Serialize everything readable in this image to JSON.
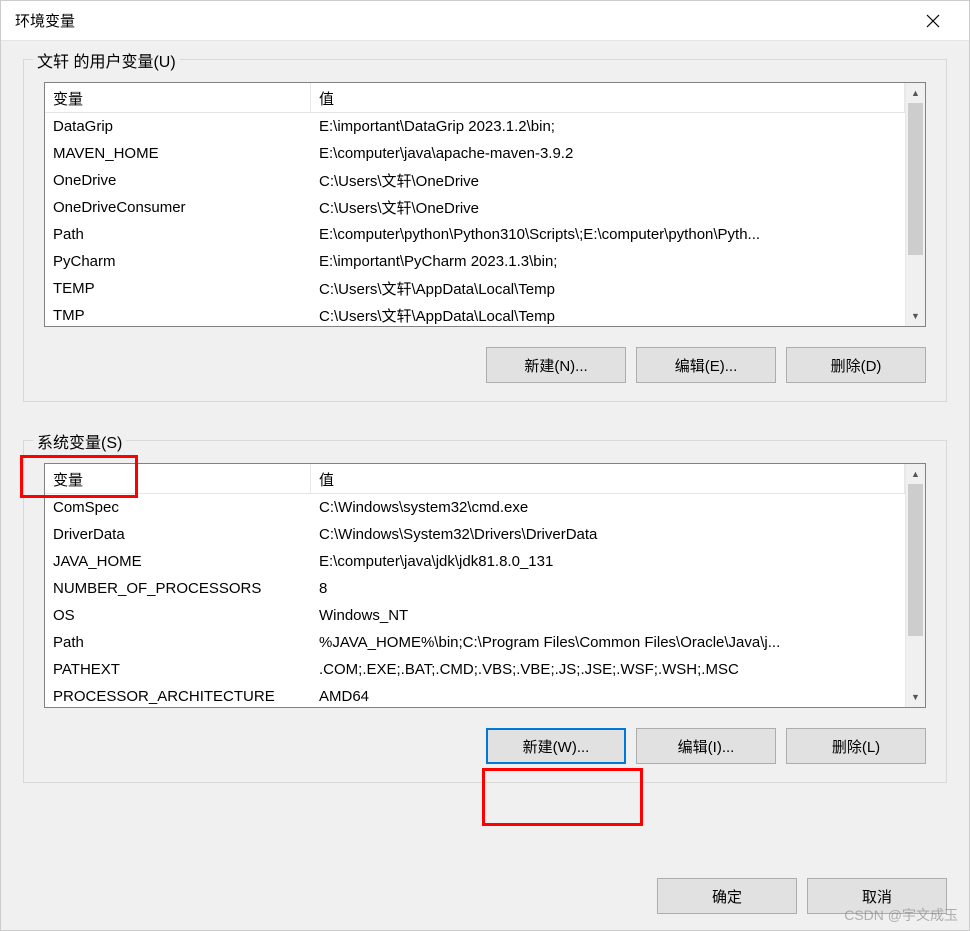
{
  "window": {
    "title": "环境变量"
  },
  "userVars": {
    "groupLabel": "文轩 的用户变量(U)",
    "headers": {
      "name": "变量",
      "value": "值"
    },
    "rows": [
      {
        "name": "DataGrip",
        "value": "E:\\important\\DataGrip 2023.1.2\\bin;"
      },
      {
        "name": "MAVEN_HOME",
        "value": "E:\\computer\\java\\apache-maven-3.9.2"
      },
      {
        "name": "OneDrive",
        "value": "C:\\Users\\文轩\\OneDrive"
      },
      {
        "name": "OneDriveConsumer",
        "value": "C:\\Users\\文轩\\OneDrive"
      },
      {
        "name": "Path",
        "value": "E:\\computer\\python\\Python310\\Scripts\\;E:\\computer\\python\\Pyth..."
      },
      {
        "name": "PyCharm",
        "value": "E:\\important\\PyCharm 2023.1.3\\bin;"
      },
      {
        "name": "TEMP",
        "value": "C:\\Users\\文轩\\AppData\\Local\\Temp"
      },
      {
        "name": "TMP",
        "value": "C:\\Users\\文轩\\AppData\\Local\\Temp"
      }
    ],
    "buttons": {
      "new": "新建(N)...",
      "edit": "编辑(E)...",
      "delete": "删除(D)"
    }
  },
  "sysVars": {
    "groupLabel": "系统变量(S)",
    "headers": {
      "name": "变量",
      "value": "值"
    },
    "rows": [
      {
        "name": "ComSpec",
        "value": "C:\\Windows\\system32\\cmd.exe"
      },
      {
        "name": "DriverData",
        "value": "C:\\Windows\\System32\\Drivers\\DriverData"
      },
      {
        "name": "JAVA_HOME",
        "value": "E:\\computer\\java\\jdk\\jdk81.8.0_131"
      },
      {
        "name": "NUMBER_OF_PROCESSORS",
        "value": "8"
      },
      {
        "name": "OS",
        "value": "Windows_NT"
      },
      {
        "name": "Path",
        "value": "%JAVA_HOME%\\bin;C:\\Program Files\\Common Files\\Oracle\\Java\\j..."
      },
      {
        "name": "PATHEXT",
        "value": ".COM;.EXE;.BAT;.CMD;.VBS;.VBE;.JS;.JSE;.WSF;.WSH;.MSC"
      },
      {
        "name": "PROCESSOR_ARCHITECTURE",
        "value": "AMD64"
      }
    ],
    "buttons": {
      "new": "新建(W)...",
      "edit": "编辑(I)...",
      "delete": "删除(L)"
    }
  },
  "footer": {
    "ok": "确定",
    "cancel": "取消"
  },
  "watermark": "CSDN @宇文成玉"
}
